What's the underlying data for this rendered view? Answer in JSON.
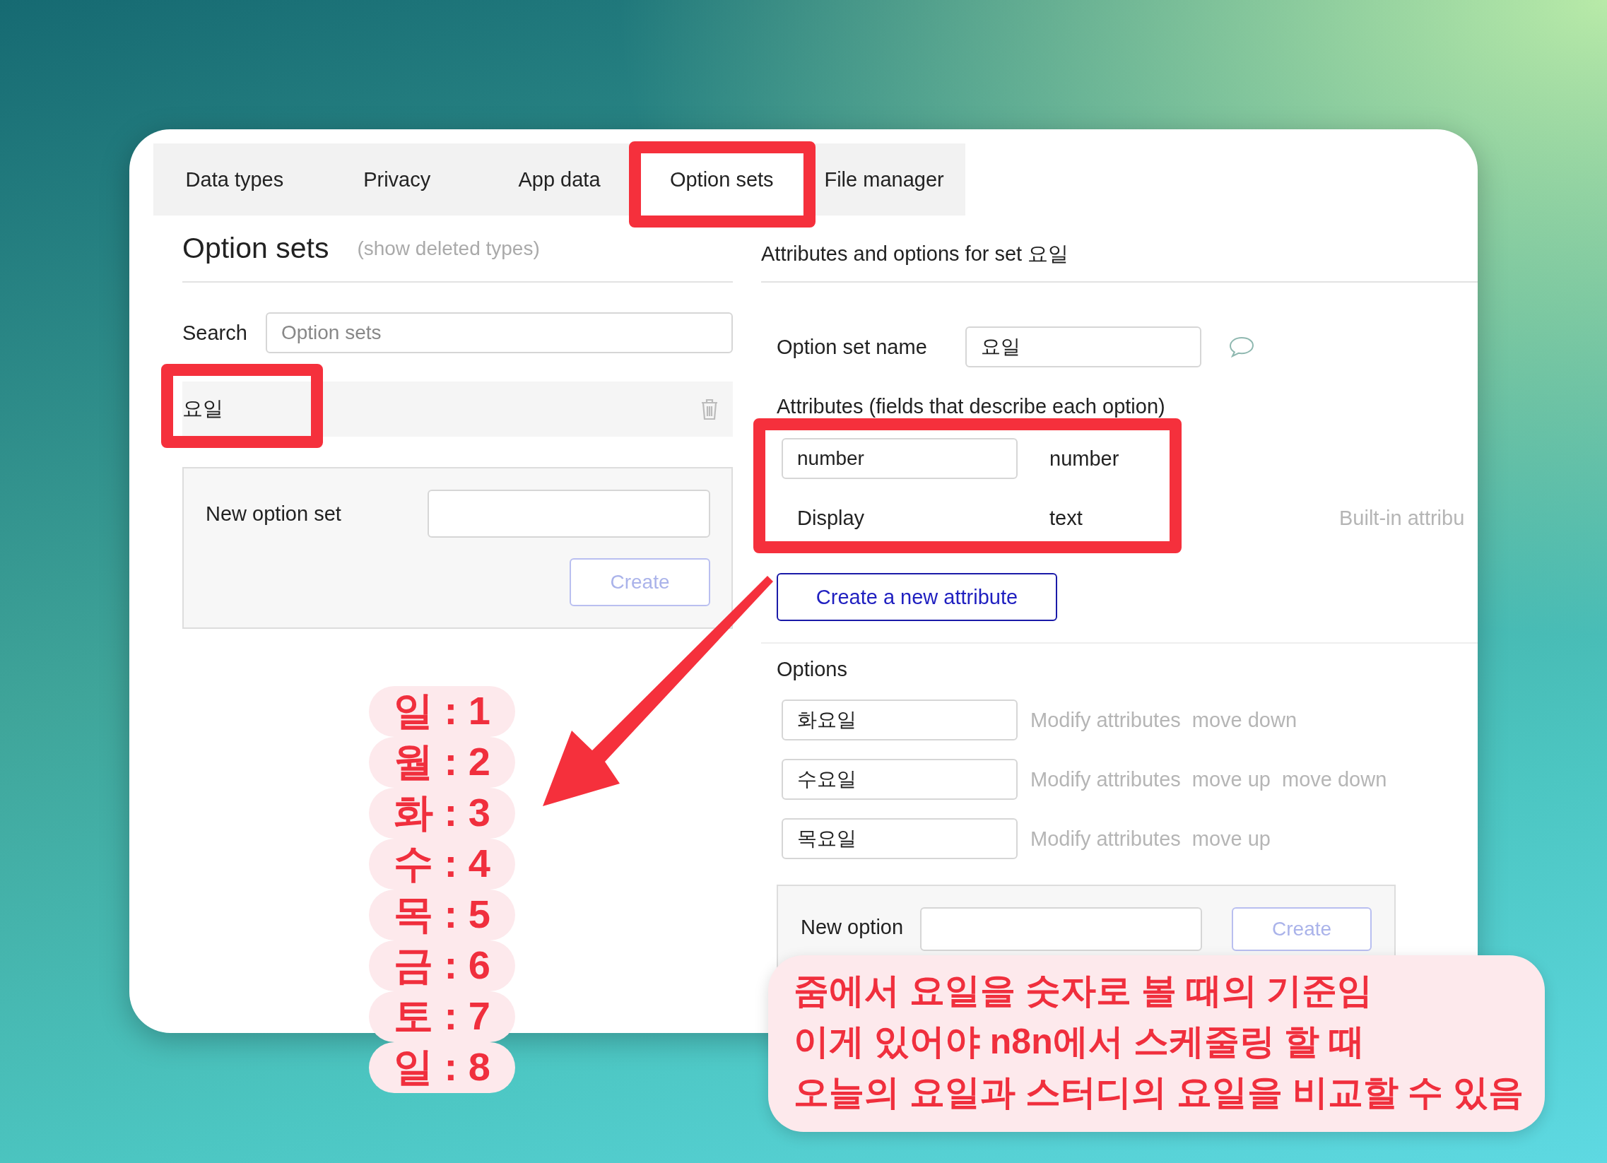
{
  "tabs": [
    {
      "label": "Data types",
      "selected": false
    },
    {
      "label": "Privacy",
      "selected": false
    },
    {
      "label": "App data",
      "selected": false
    },
    {
      "label": "Option sets",
      "selected": true
    },
    {
      "label": "File manager",
      "selected": false
    }
  ],
  "left_panel": {
    "title": "Option sets",
    "show_deleted_link": "(show deleted types)",
    "search": {
      "label": "Search",
      "placeholder": "Option sets"
    },
    "option_sets": [
      {
        "name": "요일"
      }
    ],
    "new_option_set": {
      "label": "New option set",
      "button": "Create",
      "disabled": true
    }
  },
  "right_panel": {
    "heading": "Attributes and options for set 요일",
    "name_label": "Option set name",
    "name_value": "요일",
    "attributes_label": "Attributes (fields that describe each option)",
    "attributes": [
      {
        "kind": "editable",
        "name": "number",
        "type": "number"
      },
      {
        "kind": "builtin",
        "name": "Display",
        "type": "text",
        "note": "Built-in attribu"
      }
    ],
    "create_attribute_button": "Create a new attribute",
    "options_label": "Options",
    "options": [
      {
        "value": "화요일",
        "actions": [
          "Modify attributes",
          "move down"
        ]
      },
      {
        "value": "수요일",
        "actions": [
          "Modify attributes",
          "move up",
          "move down"
        ]
      },
      {
        "value": "목요일",
        "actions": [
          "Modify attributes",
          "move up"
        ]
      }
    ],
    "new_option": {
      "label": "New option",
      "button": "Create",
      "disabled": true
    }
  },
  "annotations": {
    "day_numbers": [
      "일 : 1",
      "월 : 2",
      "화 : 3",
      "수 : 4",
      "목 : 5",
      "금 : 6",
      "토 : 7",
      "일 : 8"
    ],
    "callout": [
      "줌에서 요일을 숫자로 볼 때의 기준임",
      "이게 있어야 n8n에서 스케줄링 할 때",
      "오늘의 요일과 스터디의 요일을 비교할 수 있음"
    ]
  }
}
